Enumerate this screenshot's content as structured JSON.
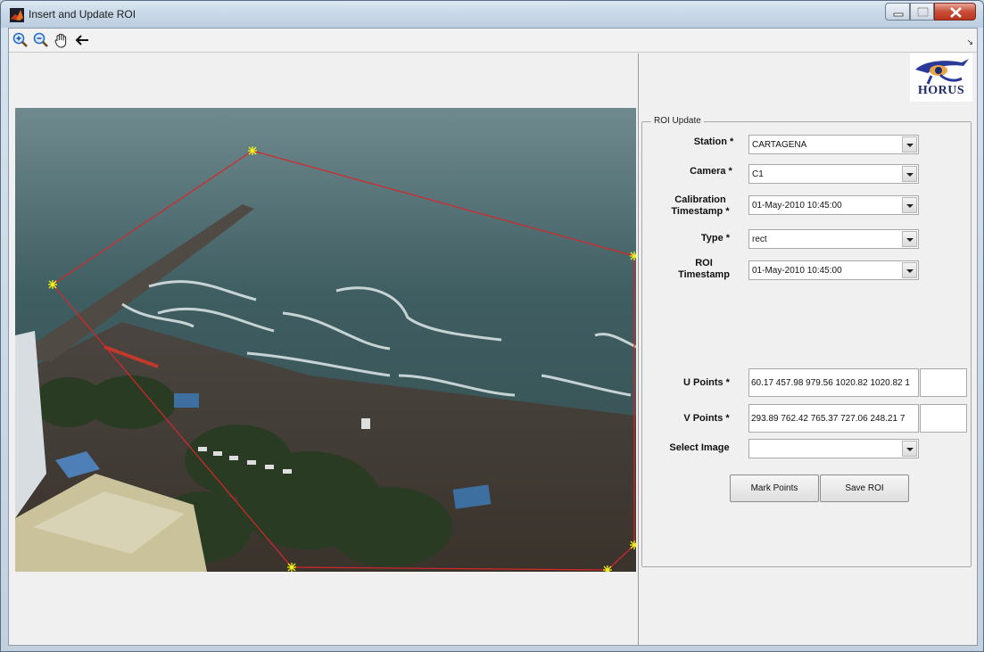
{
  "window": {
    "title": "Insert and Update ROI",
    "icon": "matlab-icon",
    "controls": [
      "minimize-icon",
      "maximize-icon",
      "close-icon"
    ]
  },
  "toolbar": {
    "tools": [
      "zoom-in-icon",
      "zoom-out-icon",
      "pan-hand-icon",
      "back-arrow-icon"
    ]
  },
  "image": {
    "description_icon": "camera-image",
    "roi_color": "#d8262a",
    "marker_color": "#f5f21a"
  },
  "logo": {
    "text": "HORUS",
    "icon": "horus-eye-icon"
  },
  "roi_update": {
    "title": "ROI Update",
    "station": {
      "label": "Station *",
      "value": "CARTAGENA"
    },
    "camera": {
      "label": "Camera *",
      "value": "C1"
    },
    "calibration": {
      "label_line1": "Calibration",
      "label_line2": "Timestamp *",
      "value": "01-May-2010 10:45:00"
    },
    "type": {
      "label": "Type *",
      "value": "rect"
    },
    "roi_timestamp": {
      "label_line1": "ROI",
      "label_line2": "Timestamp",
      "value": "01-May-2010 10:45:00"
    },
    "u_points": {
      "label": "U Points *",
      "value": "60.17 457.98 979.56 1020.82 1020.82 1",
      "extra": ""
    },
    "v_points": {
      "label": "V Points *",
      "value": "293.89 762.42 765.37 727.06 248.21 7",
      "extra": ""
    },
    "select_image": {
      "label": "Select Image",
      "value": ""
    },
    "mark_points_label": "Mark Points",
    "save_roi_label": "Save ROI"
  }
}
